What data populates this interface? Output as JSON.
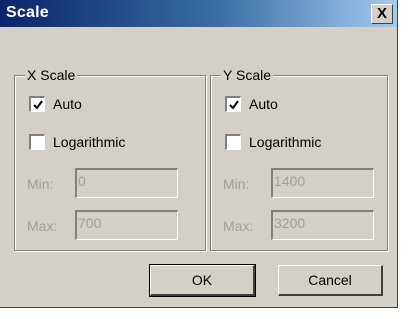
{
  "window": {
    "title": "Scale",
    "close_glyph": "X"
  },
  "x_scale": {
    "label": "X Scale",
    "auto_label": "Auto",
    "auto_checked": true,
    "log_label": "Logarithmic",
    "log_checked": false,
    "min_label": "Min:",
    "min_value": "0",
    "max_label": "Max:",
    "max_value": "700"
  },
  "y_scale": {
    "label": "Y Scale",
    "auto_label": "Auto",
    "auto_checked": true,
    "log_label": "Logarithmic",
    "log_checked": false,
    "min_label": "Min:",
    "min_value": "1400",
    "max_label": "Max:",
    "max_value": "3200"
  },
  "buttons": {
    "ok_label": "OK",
    "cancel_label": "Cancel"
  },
  "colors": {
    "title_bar_start": "#0a246a",
    "title_bar_end": "#a6caf0",
    "face": "#d4d0c8",
    "disabled_text": "#a0a0a0"
  }
}
